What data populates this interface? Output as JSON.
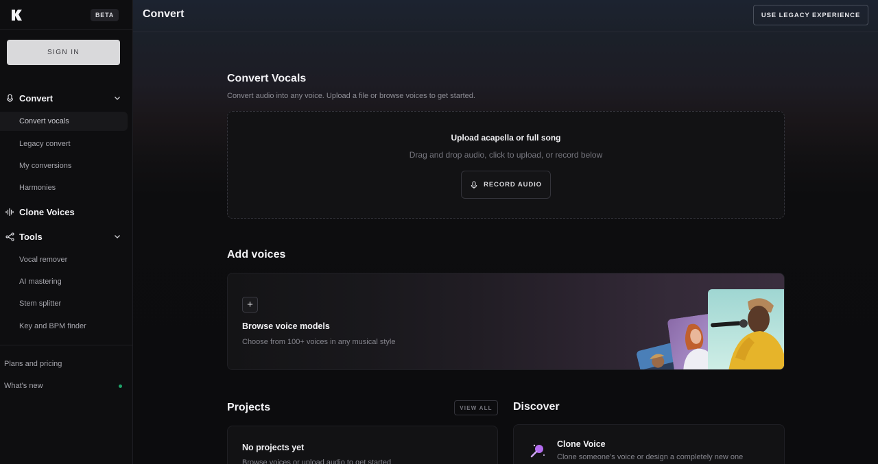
{
  "sidebar": {
    "beta_badge": "BETA",
    "sign_in": "SIGN IN",
    "convert": {
      "label": "Convert",
      "items": [
        "Convert vocals",
        "Legacy convert",
        "My conversions",
        "Harmonies"
      ]
    },
    "clone_voices": {
      "label": "Clone Voices"
    },
    "tools": {
      "label": "Tools",
      "items": [
        "Vocal remover",
        "AI mastering",
        "Stem splitter",
        "Key and BPM finder"
      ]
    },
    "plans": "Plans and pricing",
    "whats_new": "What's new"
  },
  "header": {
    "title": "Convert",
    "legacy_button": "USE LEGACY EXPERIENCE"
  },
  "convert_vocals": {
    "title": "Convert Vocals",
    "subtitle": "Convert audio into any voice. Upload a file or browse voices to get started.",
    "upload_title": "Upload acapella or full song",
    "upload_sub": "Drag and drop audio, click to upload, or record below",
    "record_button": "RECORD AUDIO"
  },
  "add_voices": {
    "title": "Add voices",
    "card_title": "Browse voice models",
    "card_sub": "Choose from 100+ voices in any musical style"
  },
  "projects": {
    "title": "Projects",
    "view_all": "VIEW ALL",
    "empty_title": "No projects yet",
    "empty_sub": "Browse voices or upload audio to get started"
  },
  "discover": {
    "title": "Discover",
    "card_title": "Clone Voice",
    "card_sub": "Clone someone’s voice or design a completely new one"
  },
  "colors": {
    "accent_purple": "#b46cf0",
    "status_green": "#1fa36a"
  }
}
